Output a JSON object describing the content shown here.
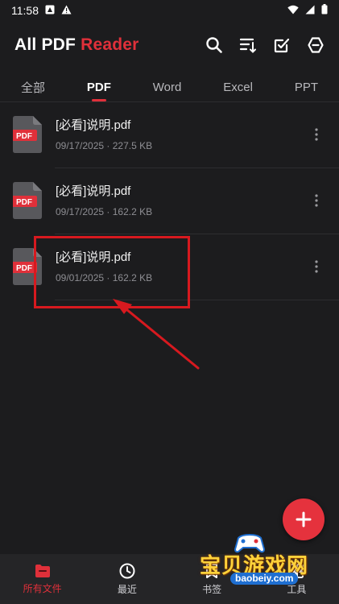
{
  "status_bar": {
    "time": "11:58"
  },
  "app": {
    "title_main": "All PDF",
    "title_accent": "Reader"
  },
  "toolbar": {
    "search_icon": "search-icon",
    "sort_icon": "sort-icon",
    "select_icon": "checkbox-icon",
    "menu_icon": "minus-circle-icon"
  },
  "tabs": [
    {
      "label": "全部",
      "active": false
    },
    {
      "label": "PDF",
      "active": true
    },
    {
      "label": "Word",
      "active": false
    },
    {
      "label": "Excel",
      "active": false
    },
    {
      "label": "PPT",
      "active": false
    }
  ],
  "files": [
    {
      "name": "[必看]说明.pdf",
      "meta": "09/17/2025 · 227.5 KB",
      "badge": "PDF"
    },
    {
      "name": "[必看]说明.pdf",
      "meta": "09/17/2025 · 162.2 KB",
      "badge": "PDF"
    },
    {
      "name": "[必看]说明.pdf",
      "meta": "09/01/2025 · 162.2 KB",
      "badge": "PDF"
    }
  ],
  "bottom_nav": [
    {
      "label": "所有文件",
      "active": true,
      "icon": "folder-icon"
    },
    {
      "label": "最近",
      "active": false,
      "icon": "clock-icon"
    },
    {
      "label": "书签",
      "active": false,
      "icon": "bookmark-icon"
    },
    {
      "label": "工具",
      "active": false,
      "icon": "tools-icon"
    }
  ],
  "watermark": {
    "text": "宝贝游戏网",
    "sub": "baobeiy.com"
  },
  "colors": {
    "accent": "#e0303a",
    "background": "#1c1c1e",
    "annotation": "#d7191f"
  }
}
